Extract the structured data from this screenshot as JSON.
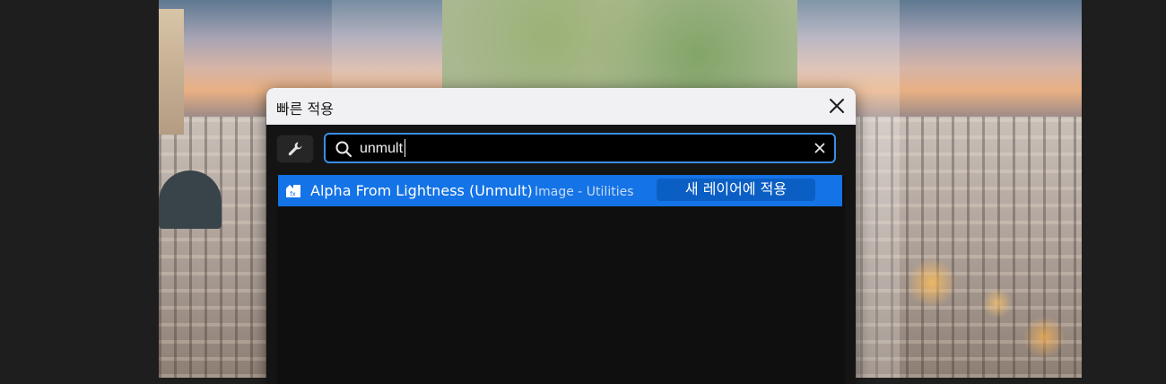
{
  "dialog": {
    "title": "빠른 적용",
    "close_icon": "close-icon"
  },
  "toolbar": {
    "tool_icon": "wrench-icon"
  },
  "search": {
    "icon": "search-icon",
    "value": "unmult",
    "clear_icon": "clear-x-icon"
  },
  "results": [
    {
      "icon": "effect-preset-icon",
      "name": "Alpha From Lightness (Unmult)",
      "category": "Image - Utilities",
      "action_label": "새 레이어에 적용",
      "selected": true
    }
  ],
  "colors": {
    "accent": "#1473e6",
    "action_bg": "#0b5fc4",
    "search_border": "#3a8ee6"
  }
}
